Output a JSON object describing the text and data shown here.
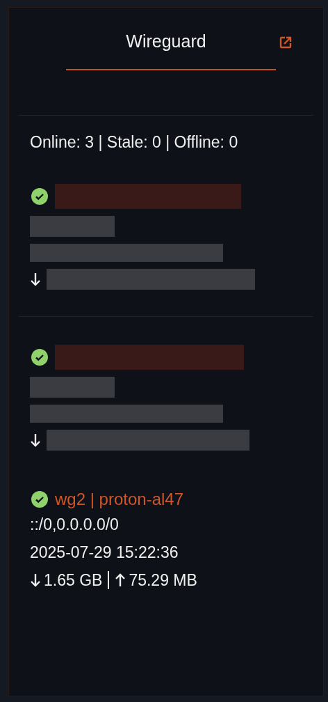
{
  "widget": {
    "title": "Wireguard",
    "summary": "Online: 3 | Stale: 0 | Offline: 0"
  },
  "peers": [
    {
      "kind": "redacted",
      "online": true
    },
    {
      "kind": "redacted",
      "online": true
    },
    {
      "kind": "visible",
      "online": true,
      "name": "wg2 | proton-al47",
      "allowed_ips": "::/0,0.0.0.0/0",
      "handshake": "2025-07-29 15:22:36",
      "received": "1.65 GB",
      "sent": "75.29 MB"
    }
  ]
}
